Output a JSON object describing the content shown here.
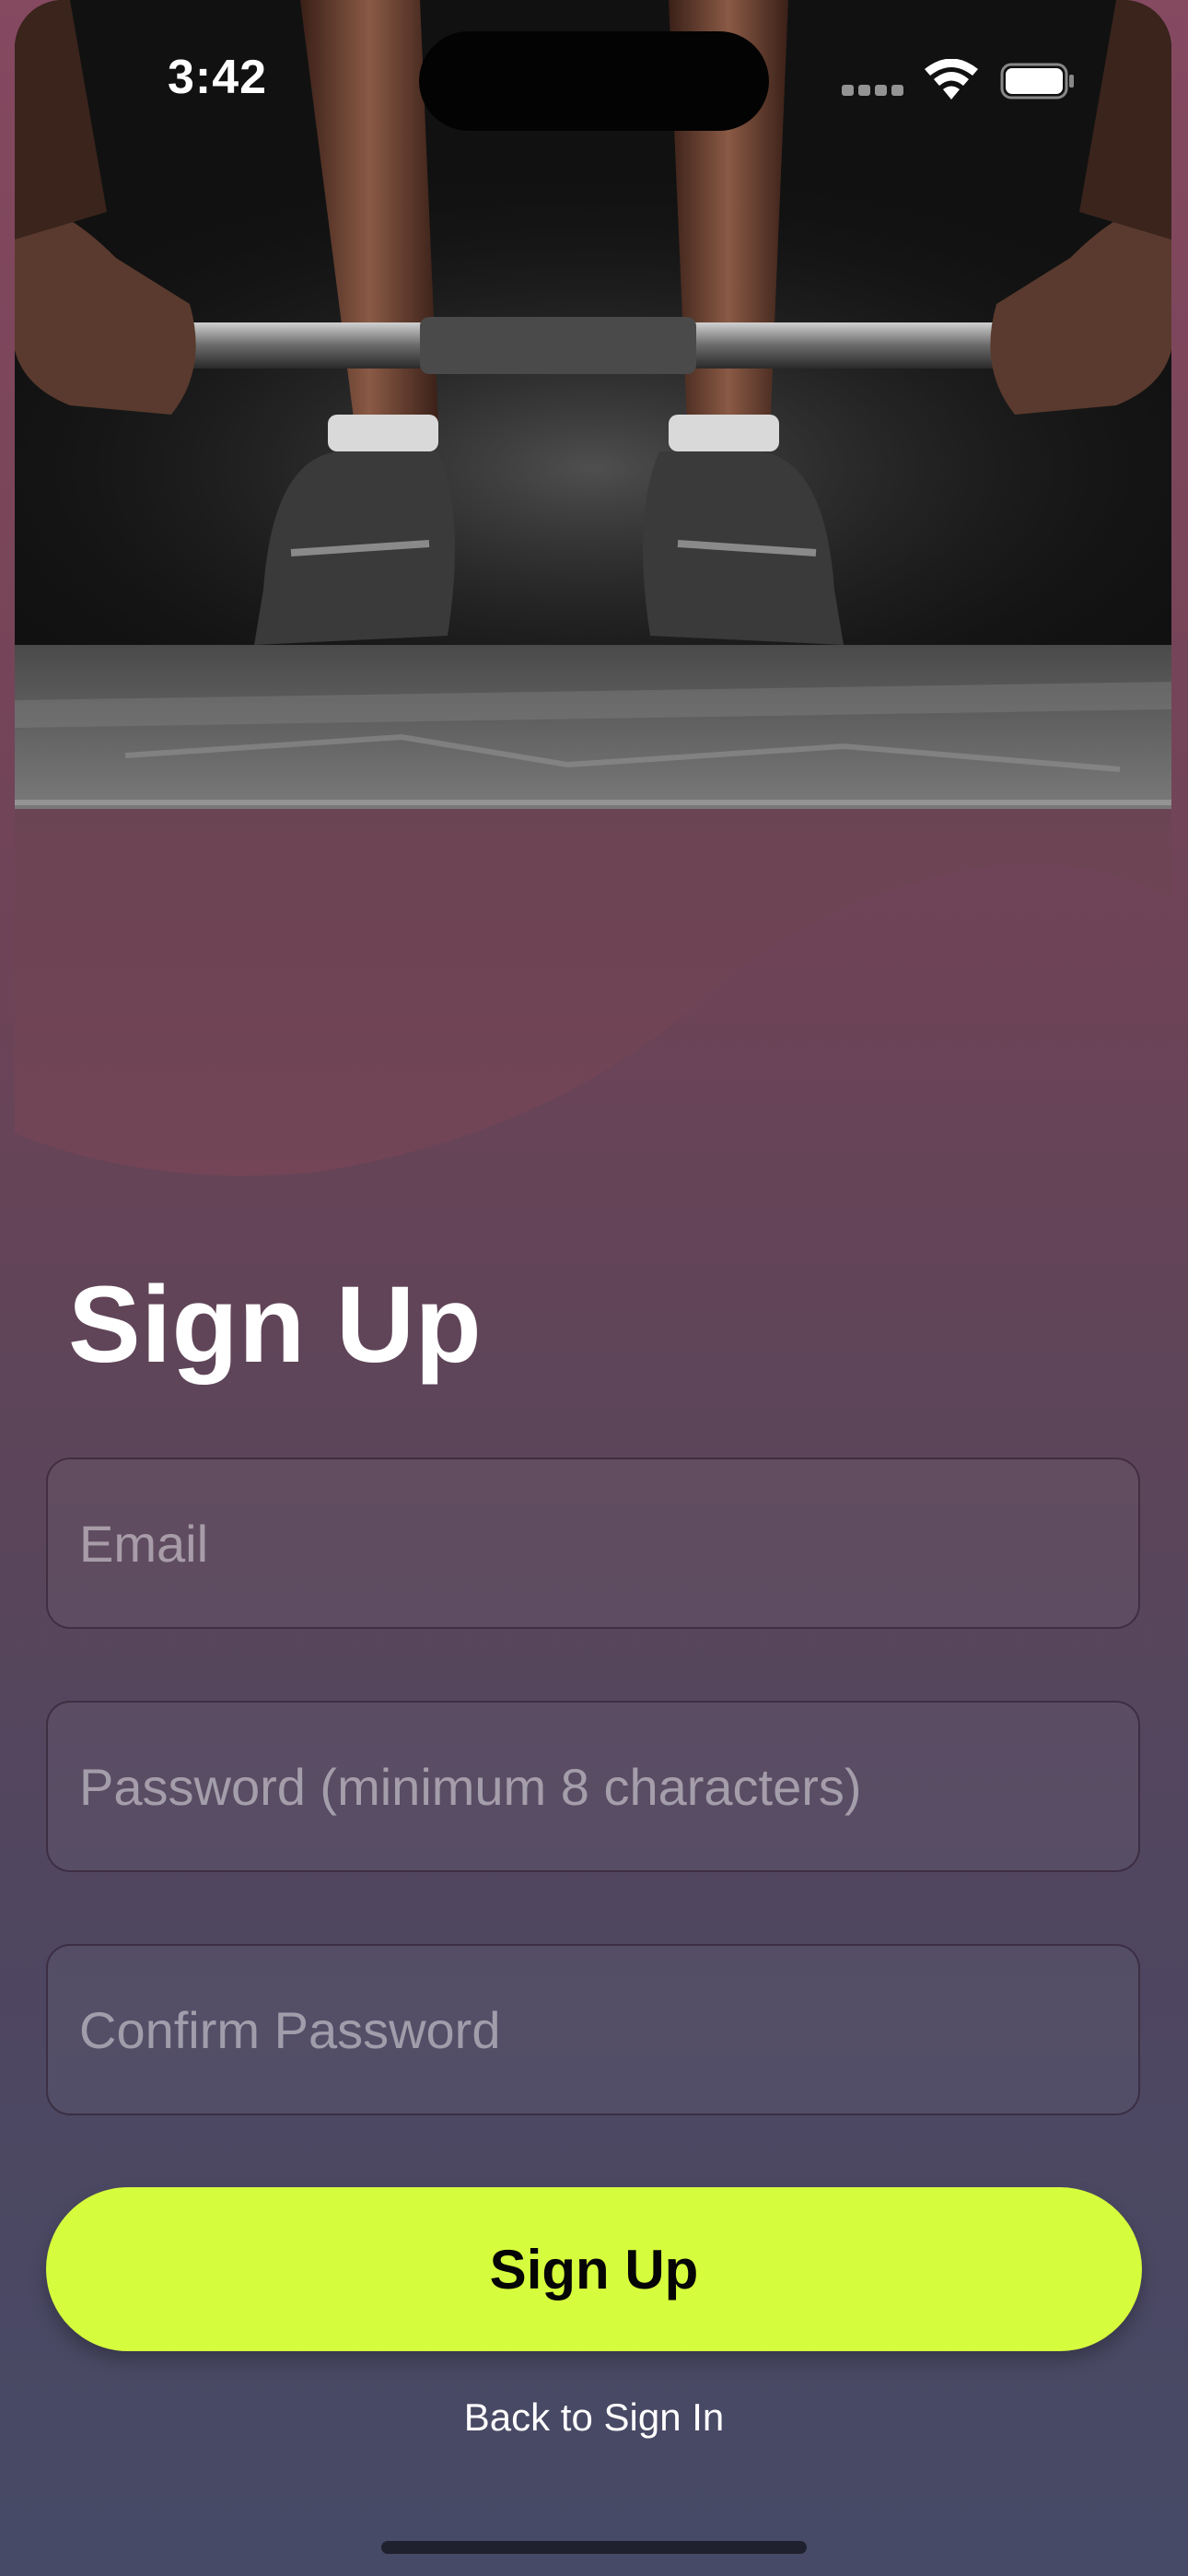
{
  "status_bar": {
    "time": "3:42",
    "wifi_icon": "wifi-icon",
    "battery_icon": "battery-icon"
  },
  "hero": {
    "image_icon": "weightlifting-photo"
  },
  "form": {
    "title": "Sign Up",
    "email_placeholder": "Email",
    "email_value": "",
    "password_placeholder": "Password (minimum 8 characters)",
    "password_value": "",
    "confirm_placeholder": "Confirm Password",
    "confirm_value": "",
    "submit_label": "Sign Up",
    "back_label": "Back to Sign In"
  },
  "colors": {
    "accent": "#d6fd3d",
    "background_top": "#854960",
    "background_bottom": "#464a66"
  }
}
